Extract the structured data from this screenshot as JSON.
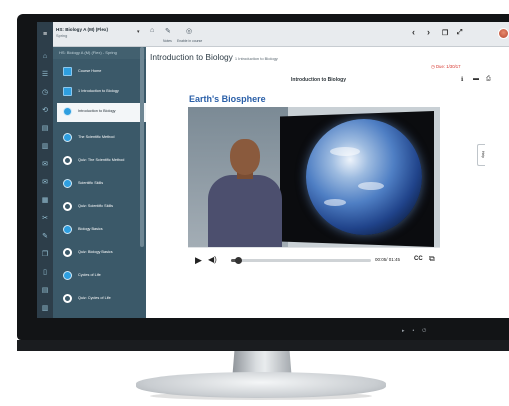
{
  "app": {
    "course_title": "HS: Biology A (M) (Flex)",
    "course_term": "Spring",
    "toolbar": {
      "notes_label": "Notes",
      "bookmark_label": "Enable in course"
    },
    "nav": {
      "prev_icon": "chevron-left-icon",
      "next_icon": "chevron-right-icon"
    }
  },
  "sidebar": {
    "header": "HS: Biology A (M) (Flex) - Spring",
    "items": [
      {
        "label": "Course Home",
        "icon": "square-icon"
      },
      {
        "label": "1 Introduction to Biology",
        "icon": "square-icon"
      },
      {
        "label": "Introduction to Biology",
        "icon": "circle-icon",
        "selected": true
      },
      {
        "label": "The Scientific Method",
        "icon": "circle-icon"
      },
      {
        "label": "Quiz: The Scientific Method",
        "icon": "ring-icon"
      },
      {
        "label": "Scientific Skills",
        "icon": "circle-icon"
      },
      {
        "label": "Quiz: Scientific Skills",
        "icon": "ring-icon"
      },
      {
        "label": "Biology Basics",
        "icon": "circle-icon"
      },
      {
        "label": "Quiz: Biology Basics",
        "icon": "ring-icon"
      },
      {
        "label": "Cycles of Life",
        "icon": "circle-icon"
      },
      {
        "label": "Quiz: Cycles of Life",
        "icon": "ring-icon"
      }
    ]
  },
  "content": {
    "title": "Introduction to Biology",
    "breadcrumb": "1 Introduction to Biology",
    "due": "Due: 1/30/17",
    "subtitle": "Introduction to Biology",
    "lesson_heading": "Earth's Biosphere",
    "side_tab": "Help"
  },
  "video": {
    "time": "00:05/ 01:45",
    "progress_fraction": 0.048,
    "volume_fraction": 0.1,
    "cc_label": "CC"
  },
  "colors": {
    "sidebar_bg": "#3b5969",
    "rail_bg": "#2d3e4a",
    "accent": "#2e9fe0",
    "heading": "#2a5fa8",
    "due": "#d5322a"
  }
}
